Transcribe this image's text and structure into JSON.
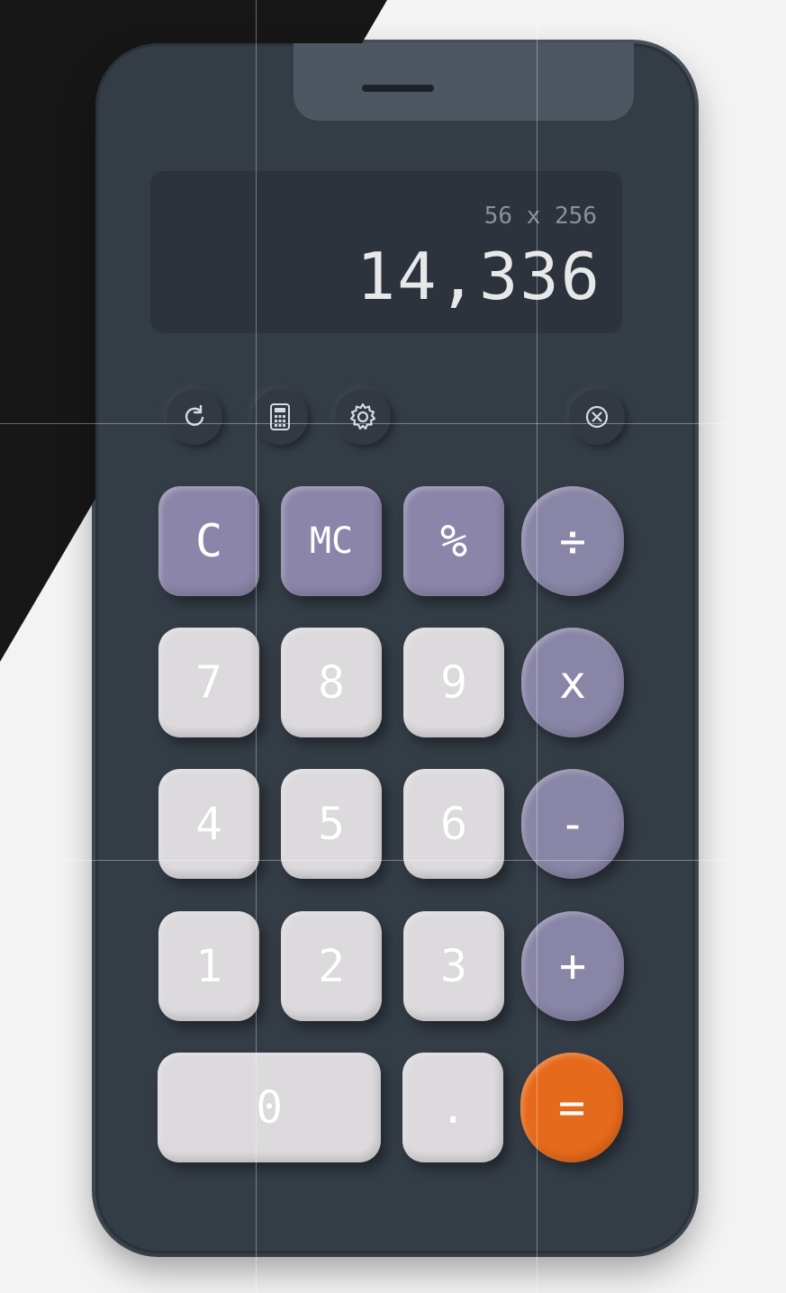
{
  "display": {
    "expression": "56 x 256",
    "result": "14,336"
  },
  "toolbar": {
    "history_icon": "history-icon",
    "calculator_icon": "calculator-icon",
    "settings_icon": "gear-icon",
    "close_icon": "close-icon"
  },
  "keys": {
    "clear": "C",
    "memory_clear": "MC",
    "percent": "%",
    "divide": "÷",
    "seven": "7",
    "eight": "8",
    "nine": "9",
    "multiply": "x",
    "four": "4",
    "five": "5",
    "six": "6",
    "minus": "-",
    "one": "1",
    "two": "2",
    "three": "3",
    "plus": "+",
    "zero": "0",
    "decimal": ".",
    "equals": "="
  },
  "colors": {
    "body": "#343c46",
    "function_key": "#8b86a9",
    "number_key": "#dcdadc",
    "equals_key": "#e66a1b"
  }
}
